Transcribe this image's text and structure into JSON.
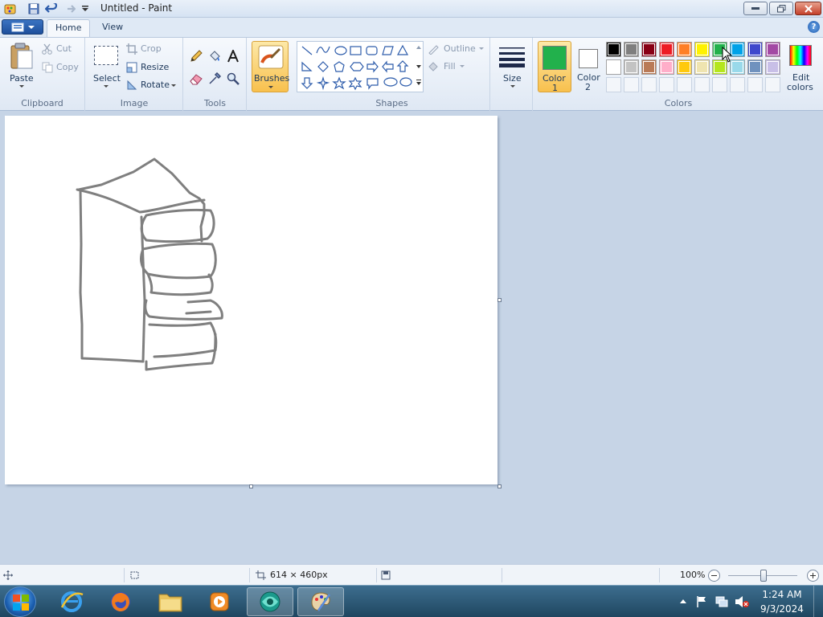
{
  "window": {
    "title": "Untitled - Paint"
  },
  "tabs": [
    {
      "label": "Home"
    },
    {
      "label": "View"
    }
  ],
  "clipboard": {
    "paste": "Paste",
    "cut": "Cut",
    "copy": "Copy",
    "group": "Clipboard"
  },
  "image": {
    "select": "Select",
    "crop": "Crop",
    "resize": "Resize",
    "rotate": "Rotate",
    "group": "Image"
  },
  "tools": {
    "group": "Tools"
  },
  "brushes": {
    "label": "Brushes"
  },
  "shapes": {
    "outline": "Outline",
    "fill": "Fill",
    "group": "Shapes"
  },
  "size": {
    "label": "Size"
  },
  "colors": {
    "color1": "Color",
    "color1_n": "1",
    "color2": "Color",
    "color2_n": "2",
    "edit1": "Edit",
    "edit2": "colors",
    "group": "Colors",
    "color1_value": "#22b14c",
    "color2_value": "#ffffff",
    "row1": [
      "#000000",
      "#7f7f7f",
      "#880015",
      "#ed1c24",
      "#ff7f27",
      "#fff200",
      "#22b14c",
      "#00a2e8",
      "#3f48cc",
      "#a349a4"
    ],
    "row2": [
      "#ffffff",
      "#c3c3c3",
      "#b97a57",
      "#ffaec9",
      "#ffc90e",
      "#efe4b0",
      "#b5e61d",
      "#99d9ea",
      "#7092be",
      "#c8bfe7"
    ]
  },
  "status": {
    "size": "614 × 460px",
    "zoom": "100%"
  },
  "clock": {
    "time": "1:24 AM",
    "date": "9/3/2024"
  }
}
